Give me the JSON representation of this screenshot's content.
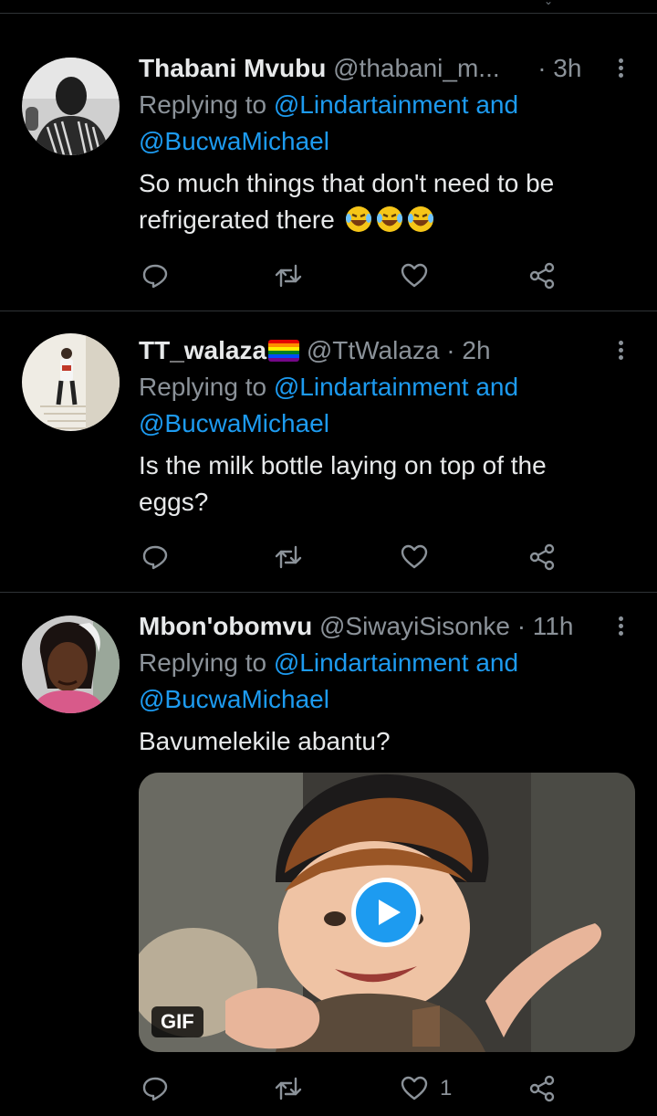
{
  "tweets": [
    {
      "name": "Thabani Mvubu",
      "handle": "@thabani_m...",
      "time": "· 3h",
      "replying_prefix": "Replying to",
      "mention1": "@Lindartainment",
      "and_word": "and",
      "mention2": "@BucwaMichael",
      "body_line1": "So much things that don't need to be",
      "body_line2": "refrigerated there",
      "emoji": [
        "face-with-tears-of-joy",
        "face-with-tears-of-joy",
        "face-with-tears-of-joy"
      ],
      "like_count": ""
    },
    {
      "name": "TT_walaza",
      "flag": "rainbow-flag",
      "handle": "@TtWalaza",
      "time": "· 2h",
      "replying_prefix": "Replying to",
      "mention1": "@Lindartainment",
      "and_word": "and",
      "mention2": "@BucwaMichael",
      "body_line1": "Is the milk bottle laying on top of the",
      "body_line2": "eggs?",
      "like_count": ""
    },
    {
      "name": "Mbon'obomvu",
      "handle": "@SiwayiSisonke",
      "time": "· 11h",
      "replying_prefix": "Replying to",
      "mention1": "@Lindartainment",
      "and_word": "and",
      "mention2": "@BucwaMichael",
      "body_line1": "Bavumelekile abantu?",
      "media_badge": "GIF",
      "media_icon": "play-icon",
      "like_count": "1"
    }
  ],
  "colors": {
    "background": "#000000",
    "mention": "#1d9bf0",
    "muted": "#8b9299",
    "text": "#e7e9ea"
  }
}
